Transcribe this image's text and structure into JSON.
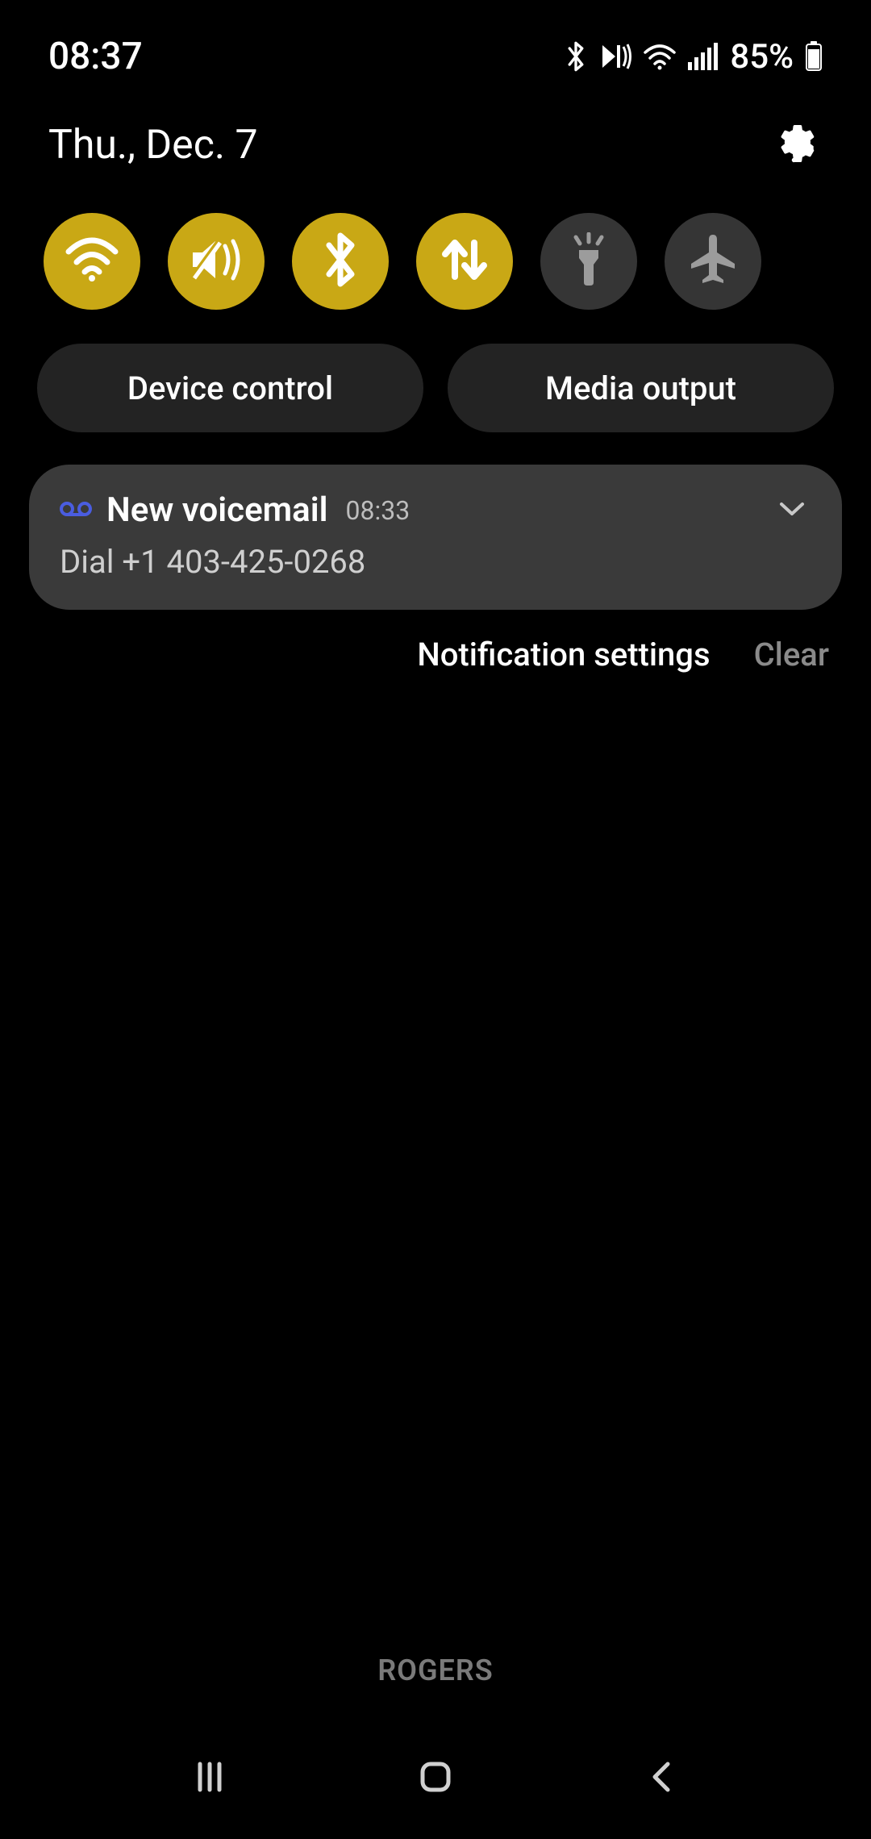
{
  "status": {
    "time": "08:37",
    "battery_pct": "85%"
  },
  "panel": {
    "date": "Thu., Dec. 7"
  },
  "qs": {
    "items": [
      {
        "name": "wifi",
        "on": true
      },
      {
        "name": "mute",
        "on": true
      },
      {
        "name": "bluetooth",
        "on": true
      },
      {
        "name": "mobiledata",
        "on": true
      },
      {
        "name": "flashlight",
        "on": false
      },
      {
        "name": "airplane",
        "on": false
      }
    ]
  },
  "pills": {
    "device_control": "Device control",
    "media_output": "Media output"
  },
  "notification": {
    "title": "New voicemail",
    "time": "08:33",
    "body": "Dial +1 403-425-0268"
  },
  "notif_footer": {
    "settings": "Notification settings",
    "clear": "Clear"
  },
  "carrier": "ROGERS"
}
